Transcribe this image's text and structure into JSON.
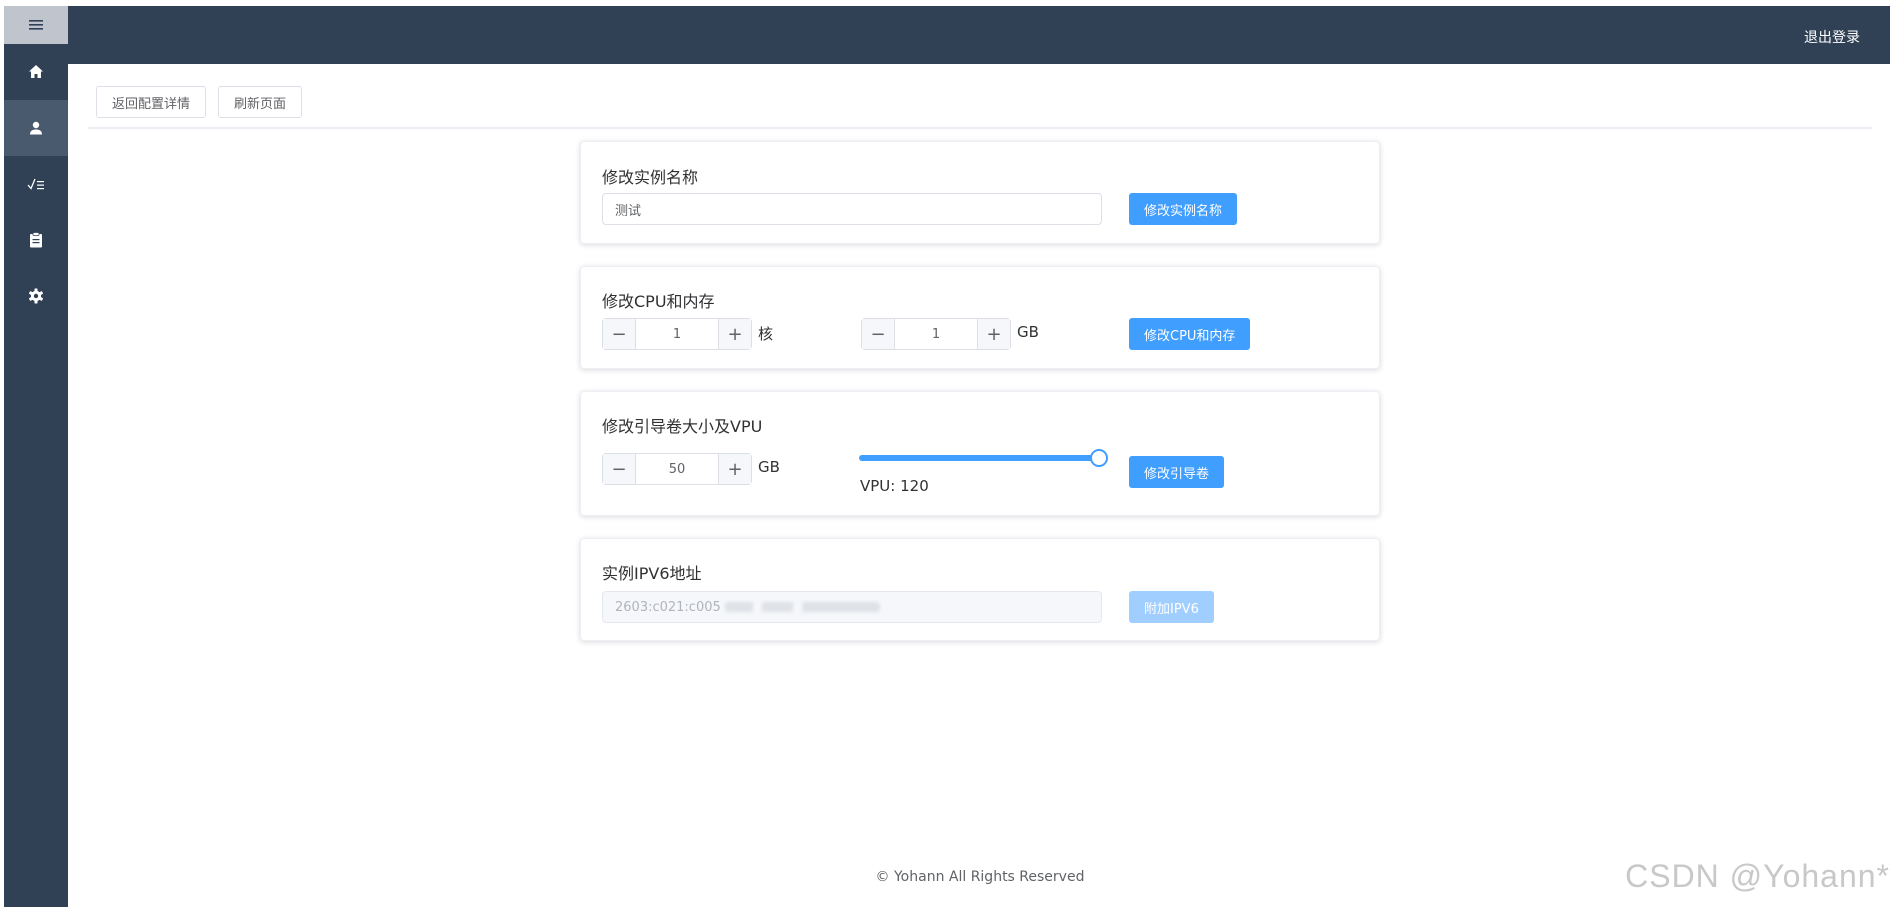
{
  "topbar": {
    "logout_label": "退出登录"
  },
  "sidebar": {
    "items": [
      {
        "icon": "home-icon",
        "active": false
      },
      {
        "icon": "user-icon",
        "active": true
      },
      {
        "icon": "checklist-icon",
        "active": false
      },
      {
        "icon": "clipboard-icon",
        "active": false
      },
      {
        "icon": "gear-icon",
        "active": false
      }
    ]
  },
  "toolbar": {
    "back_label": "返回配置详情",
    "refresh_label": "刷新页面"
  },
  "rename_card": {
    "title": "修改实例名称",
    "input_value": "测试",
    "button_label": "修改实例名称"
  },
  "cpu_card": {
    "title": "修改CPU和内存",
    "cpu_value": "1",
    "cpu_unit": "核",
    "memory_value": "1",
    "memory_unit": "GB",
    "button_label": "修改CPU和内存"
  },
  "boot_card": {
    "title": "修改引导卷大小及VPU",
    "size_value": "50",
    "size_unit": "GB",
    "vpu_label": "VPU: 120",
    "vpu_fraction": 1.0,
    "button_label": "修改引导卷"
  },
  "ipv6_card": {
    "title": "实例IPV6地址",
    "address_value": "2603:c021:c005",
    "button_label": "附加IPV6"
  },
  "footer": {
    "text": "© Yohann All Rights Reserved"
  },
  "watermark": "CSDN @Yohann*",
  "colors": {
    "sidebar": "#304156",
    "primary": "#409eff",
    "primary_disabled": "#a0cfff"
  }
}
